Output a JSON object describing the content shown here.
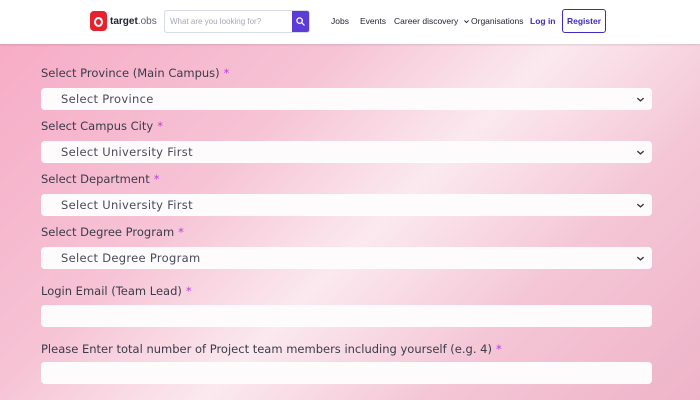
{
  "header": {
    "logo": {
      "brand": "target",
      "suffix": ".obs"
    },
    "search": {
      "placeholder": "What are you looking for?",
      "value": ""
    },
    "nav": {
      "jobs": "Jobs",
      "events": "Events",
      "career_discovery": "Career discovery",
      "organisations": "Organisations",
      "login": "Log in",
      "register": "Register"
    },
    "colors": {
      "brand_red": "#e8212e",
      "accent_purple": "#3d2bc7"
    }
  },
  "form": {
    "required_marker": "*",
    "fields": [
      {
        "label": "Select Province (Main Campus)",
        "type": "select",
        "value": "Select Province"
      },
      {
        "label": "Select Campus City",
        "type": "select",
        "value": "Select University First"
      },
      {
        "label": "Select Department",
        "type": "select",
        "value": "Select University First"
      },
      {
        "label": "Select Degree Program",
        "type": "select",
        "value": "Select Degree Program"
      },
      {
        "label": "Login Email (Team Lead)",
        "type": "text",
        "value": ""
      },
      {
        "label": "Please Enter total number of Project team members including yourself (e.g. 4)",
        "type": "text",
        "value": ""
      }
    ]
  }
}
